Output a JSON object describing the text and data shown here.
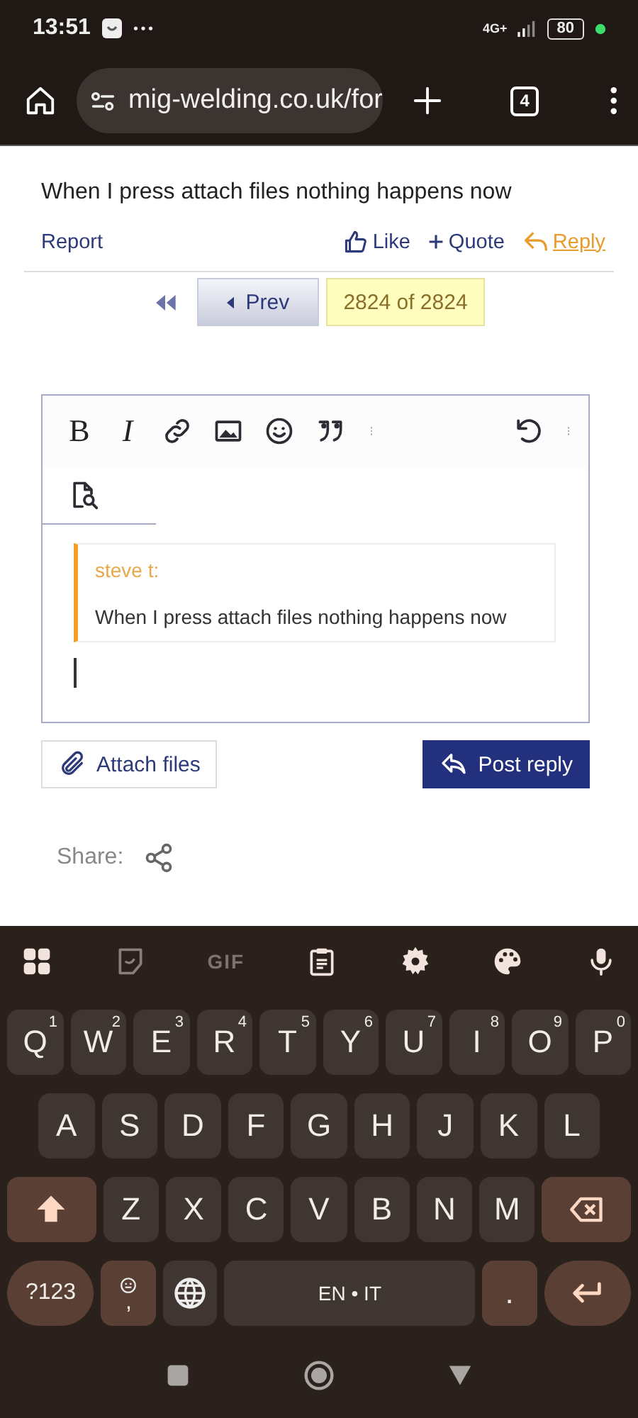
{
  "status_bar": {
    "time": "13:51",
    "network": "4G+",
    "battery": "80"
  },
  "browser": {
    "url": "mig-welding.co.uk/for",
    "tab_count": "4"
  },
  "post": {
    "text": "When I press attach files nothing happens now",
    "actions": [
      {
        "kind": "report",
        "label": "Report"
      },
      {
        "kind": "like",
        "label": "Like"
      },
      {
        "kind": "quote",
        "label": "Quote"
      },
      {
        "kind": "reply",
        "label": "Reply"
      }
    ]
  },
  "pagination": {
    "prev": "Prev",
    "current": "2824 of 2824"
  },
  "editor": {
    "toolbar": [
      {
        "kind": "text",
        "label": "B",
        "italic": false
      },
      {
        "kind": "text",
        "label": "I",
        "italic": true
      },
      {
        "kind": "link"
      },
      {
        "kind": "image"
      },
      {
        "kind": "emoji"
      },
      {
        "kind": "quote"
      },
      {
        "kind": "more"
      },
      {
        "kind": "undo"
      },
      {
        "kind": "more"
      }
    ],
    "quote": {
      "author": "steve t:",
      "text": "When I press attach files nothing happens now"
    }
  },
  "buttons": {
    "attach": "Attach files",
    "post": "Post reply"
  },
  "share": {
    "label": "Share:"
  },
  "keyboard": {
    "toolbar": [
      {
        "kind": "grid"
      },
      {
        "kind": "sticker"
      },
      {
        "kind": "text",
        "label": "GIF",
        "disabled": true
      },
      {
        "kind": "clipboard"
      },
      {
        "kind": "settings"
      },
      {
        "kind": "palette"
      },
      {
        "kind": "mic"
      }
    ],
    "rows": [
      {
        "keys": [
          {
            "kind": "letter",
            "label": "Q",
            "hint": "1"
          },
          {
            "kind": "letter",
            "label": "W",
            "hint": "2"
          },
          {
            "kind": "letter",
            "label": "E",
            "hint": "3"
          },
          {
            "kind": "letter",
            "label": "R",
            "hint": "4"
          },
          {
            "kind": "letter",
            "label": "T",
            "hint": "5"
          },
          {
            "kind": "letter",
            "label": "Y",
            "hint": "6"
          },
          {
            "kind": "letter",
            "label": "U",
            "hint": "7"
          },
          {
            "kind": "letter",
            "label": "I",
            "hint": "8"
          },
          {
            "kind": "letter",
            "label": "O",
            "hint": "9"
          },
          {
            "kind": "letter",
            "label": "P",
            "hint": "0"
          }
        ]
      },
      {
        "keys": [
          {
            "kind": "letter",
            "label": "A"
          },
          {
            "kind": "letter",
            "label": "S"
          },
          {
            "kind": "letter",
            "label": "D"
          },
          {
            "kind": "letter",
            "label": "F"
          },
          {
            "kind": "letter",
            "label": "G"
          },
          {
            "kind": "letter",
            "label": "H"
          },
          {
            "kind": "letter",
            "label": "J"
          },
          {
            "kind": "letter",
            "label": "K"
          },
          {
            "kind": "letter",
            "label": "L"
          }
        ]
      },
      {
        "keys": [
          {
            "kind": "shift"
          },
          {
            "kind": "letter",
            "label": "Z"
          },
          {
            "kind": "letter",
            "label": "X"
          },
          {
            "kind": "letter",
            "label": "C"
          },
          {
            "kind": "letter",
            "label": "V"
          },
          {
            "kind": "letter",
            "label": "B"
          },
          {
            "kind": "letter",
            "label": "N"
          },
          {
            "kind": "letter",
            "label": "M"
          },
          {
            "kind": "backspace"
          }
        ]
      },
      {
        "keys": [
          {
            "kind": "symbols",
            "label": "?123"
          },
          {
            "kind": "emoji-comma",
            "label": ","
          },
          {
            "kind": "globe"
          },
          {
            "kind": "space",
            "label": "EN • IT"
          },
          {
            "kind": "period",
            "label": "."
          },
          {
            "kind": "enter"
          }
        ]
      }
    ]
  }
}
